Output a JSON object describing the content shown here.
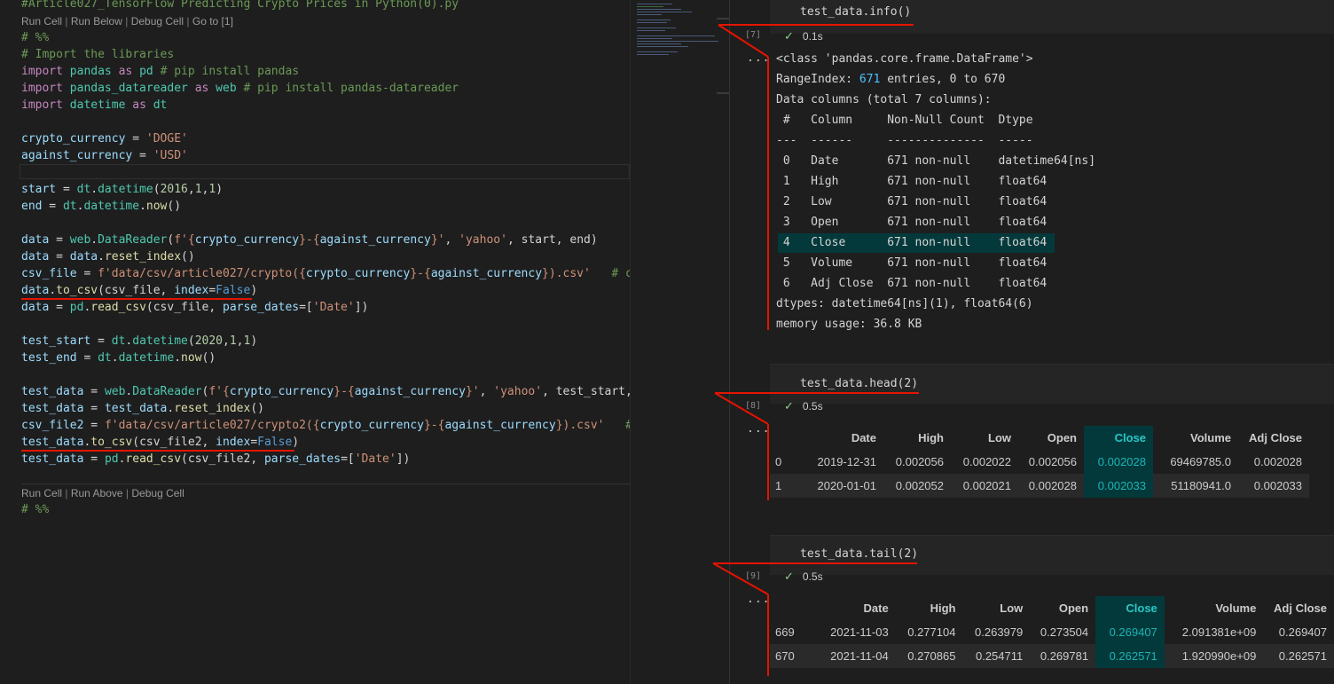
{
  "editor": {
    "file_header": "#Article027_TensorFlow Predicting Crypto Prices in Python(0).py",
    "top_lens": {
      "run_cell": "Run Cell",
      "run_below": "Run Below",
      "debug_cell": "Debug Cell",
      "go_to": "Go to [1]",
      "sep": "|"
    },
    "bottom_lens": {
      "run_cell": "Run Cell",
      "run_above": "Run Above",
      "debug_cell": "Debug Cell",
      "sep": "|"
    },
    "code_lines": [
      [
        {
          "t": "# %%",
          "c": "cmt"
        }
      ],
      [
        {
          "t": "# Import the libraries",
          "c": "cmt"
        }
      ],
      [
        {
          "t": "import",
          "c": "kw"
        },
        {
          "t": " pandas ",
          "c": "mod"
        },
        {
          "t": "as",
          "c": "kw"
        },
        {
          "t": " pd ",
          "c": "mod"
        },
        {
          "t": "# pip install pandas",
          "c": "cmt"
        }
      ],
      [
        {
          "t": "import",
          "c": "kw"
        },
        {
          "t": " pandas_datareader ",
          "c": "mod"
        },
        {
          "t": "as",
          "c": "kw"
        },
        {
          "t": " web ",
          "c": "mod"
        },
        {
          "t": "# pip install pandas-datareader",
          "c": "cmt"
        }
      ],
      [
        {
          "t": "import",
          "c": "kw"
        },
        {
          "t": " datetime ",
          "c": "mod"
        },
        {
          "t": "as",
          "c": "kw"
        },
        {
          "t": " dt",
          "c": "mod"
        }
      ],
      [],
      [
        {
          "t": "crypto_currency",
          "c": "var"
        },
        {
          "t": " = ",
          "c": "txt"
        },
        {
          "t": "'DOGE'",
          "c": "str"
        }
      ],
      [
        {
          "t": "against_currency",
          "c": "var"
        },
        {
          "t": " = ",
          "c": "txt"
        },
        {
          "t": "'USD'",
          "c": "str"
        }
      ],
      [],
      [
        {
          "t": "start",
          "c": "var"
        },
        {
          "t": " = ",
          "c": "txt"
        },
        {
          "t": "dt",
          "c": "mod"
        },
        {
          "t": ".",
          "c": "txt"
        },
        {
          "t": "datetime",
          "c": "mod"
        },
        {
          "t": "(",
          "c": "txt"
        },
        {
          "t": "2016",
          "c": "num"
        },
        {
          "t": ",",
          "c": "txt"
        },
        {
          "t": "1",
          "c": "num"
        },
        {
          "t": ",",
          "c": "txt"
        },
        {
          "t": "1",
          "c": "num"
        },
        {
          "t": ")",
          "c": "txt"
        }
      ],
      [
        {
          "t": "end",
          "c": "var"
        },
        {
          "t": " = ",
          "c": "txt"
        },
        {
          "t": "dt",
          "c": "mod"
        },
        {
          "t": ".",
          "c": "txt"
        },
        {
          "t": "datetime",
          "c": "mod"
        },
        {
          "t": ".",
          "c": "txt"
        },
        {
          "t": "now",
          "c": "fn"
        },
        {
          "t": "()",
          "c": "txt"
        }
      ],
      [],
      [
        {
          "t": "data",
          "c": "var"
        },
        {
          "t": " = ",
          "c": "txt"
        },
        {
          "t": "web",
          "c": "mod"
        },
        {
          "t": ".",
          "c": "txt"
        },
        {
          "t": "DataReader",
          "c": "mod"
        },
        {
          "t": "(",
          "c": "txt"
        },
        {
          "t": "f'{",
          "c": "str"
        },
        {
          "t": "crypto_currency",
          "c": "var"
        },
        {
          "t": "}-{",
          "c": "str"
        },
        {
          "t": "against_currency",
          "c": "var"
        },
        {
          "t": "}'",
          "c": "str"
        },
        {
          "t": ", ",
          "c": "txt"
        },
        {
          "t": "'yahoo'",
          "c": "str"
        },
        {
          "t": ", start, end)",
          "c": "txt"
        }
      ],
      [
        {
          "t": "data",
          "c": "var"
        },
        {
          "t": " = ",
          "c": "txt"
        },
        {
          "t": "data",
          "c": "var"
        },
        {
          "t": ".",
          "c": "txt"
        },
        {
          "t": "reset_index",
          "c": "fn"
        },
        {
          "t": "()",
          "c": "txt"
        }
      ],
      [
        {
          "t": "csv_file",
          "c": "var"
        },
        {
          "t": " = ",
          "c": "txt"
        },
        {
          "t": "f'data/csv/article027/crypto({",
          "c": "str"
        },
        {
          "t": "crypto_currency",
          "c": "var"
        },
        {
          "t": "}-{",
          "c": "str"
        },
        {
          "t": "against_currency",
          "c": "var"
        },
        {
          "t": "}).csv'",
          "c": "str"
        },
        {
          "t": "   # cr",
          "c": "cmt"
        }
      ],
      [
        {
          "t": "data",
          "c": "var"
        },
        {
          "t": ".",
          "c": "txt"
        },
        {
          "t": "to_csv",
          "c": "fn"
        },
        {
          "t": "(csv_file, ",
          "c": "txt"
        },
        {
          "t": "index",
          "c": "var"
        },
        {
          "t": "=",
          "c": "txt"
        },
        {
          "t": "False",
          "c": "kwb"
        },
        {
          "t": ")",
          "c": "txt"
        }
      ],
      [
        {
          "t": "data",
          "c": "var"
        },
        {
          "t": " = ",
          "c": "txt"
        },
        {
          "t": "pd",
          "c": "mod"
        },
        {
          "t": ".",
          "c": "txt"
        },
        {
          "t": "read_csv",
          "c": "fn"
        },
        {
          "t": "(csv_file, ",
          "c": "txt"
        },
        {
          "t": "parse_dates",
          "c": "var"
        },
        {
          "t": "=[",
          "c": "txt"
        },
        {
          "t": "'Date'",
          "c": "str"
        },
        {
          "t": "])",
          "c": "txt"
        }
      ],
      [],
      [
        {
          "t": "test_start",
          "c": "var"
        },
        {
          "t": " = ",
          "c": "txt"
        },
        {
          "t": "dt",
          "c": "mod"
        },
        {
          "t": ".",
          "c": "txt"
        },
        {
          "t": "datetime",
          "c": "mod"
        },
        {
          "t": "(",
          "c": "txt"
        },
        {
          "t": "2020",
          "c": "num"
        },
        {
          "t": ",",
          "c": "txt"
        },
        {
          "t": "1",
          "c": "num"
        },
        {
          "t": ",",
          "c": "txt"
        },
        {
          "t": "1",
          "c": "num"
        },
        {
          "t": ")",
          "c": "txt"
        }
      ],
      [
        {
          "t": "test_end",
          "c": "var"
        },
        {
          "t": " = ",
          "c": "txt"
        },
        {
          "t": "dt",
          "c": "mod"
        },
        {
          "t": ".",
          "c": "txt"
        },
        {
          "t": "datetime",
          "c": "mod"
        },
        {
          "t": ".",
          "c": "txt"
        },
        {
          "t": "now",
          "c": "fn"
        },
        {
          "t": "()",
          "c": "txt"
        }
      ],
      [],
      [
        {
          "t": "test_data",
          "c": "var"
        },
        {
          "t": " = ",
          "c": "txt"
        },
        {
          "t": "web",
          "c": "mod"
        },
        {
          "t": ".",
          "c": "txt"
        },
        {
          "t": "DataReader",
          "c": "mod"
        },
        {
          "t": "(",
          "c": "txt"
        },
        {
          "t": "f'{",
          "c": "str"
        },
        {
          "t": "crypto_currency",
          "c": "var"
        },
        {
          "t": "}-{",
          "c": "str"
        },
        {
          "t": "against_currency",
          "c": "var"
        },
        {
          "t": "}'",
          "c": "str"
        },
        {
          "t": ", ",
          "c": "txt"
        },
        {
          "t": "'yahoo'",
          "c": "str"
        },
        {
          "t": ", test_start, t",
          "c": "txt"
        }
      ],
      [
        {
          "t": "test_data",
          "c": "var"
        },
        {
          "t": " = ",
          "c": "txt"
        },
        {
          "t": "test_data",
          "c": "var"
        },
        {
          "t": ".",
          "c": "txt"
        },
        {
          "t": "reset_index",
          "c": "fn"
        },
        {
          "t": "()",
          "c": "txt"
        }
      ],
      [
        {
          "t": "csv_file2",
          "c": "var"
        },
        {
          "t": " = ",
          "c": "txt"
        },
        {
          "t": "f'data/csv/article027/crypto2({",
          "c": "str"
        },
        {
          "t": "crypto_currency",
          "c": "var"
        },
        {
          "t": "}-{",
          "c": "str"
        },
        {
          "t": "against_currency",
          "c": "var"
        },
        {
          "t": "}).csv'",
          "c": "str"
        },
        {
          "t": "   # ",
          "c": "cmt"
        }
      ],
      [
        {
          "t": "test_data",
          "c": "var"
        },
        {
          "t": ".",
          "c": "txt"
        },
        {
          "t": "to_csv",
          "c": "fn"
        },
        {
          "t": "(csv_file2, ",
          "c": "txt"
        },
        {
          "t": "index",
          "c": "var"
        },
        {
          "t": "=",
          "c": "txt"
        },
        {
          "t": "False",
          "c": "kwb"
        },
        {
          "t": ")",
          "c": "txt"
        }
      ],
      [
        {
          "t": "test_data",
          "c": "var"
        },
        {
          "t": " = ",
          "c": "txt"
        },
        {
          "t": "pd",
          "c": "mod"
        },
        {
          "t": ".",
          "c": "txt"
        },
        {
          "t": "read_csv",
          "c": "fn"
        },
        {
          "t": "(csv_file2, ",
          "c": "txt"
        },
        {
          "t": "parse_dates",
          "c": "var"
        },
        {
          "t": "=[",
          "c": "txt"
        },
        {
          "t": "'Date'",
          "c": "str"
        },
        {
          "t": "])",
          "c": "txt"
        }
      ]
    ],
    "trailing_line": "# %%"
  },
  "notebook": {
    "cells": [
      {
        "code": "test_data.info()",
        "count": "[7]",
        "time": "0.1s",
        "more": "...",
        "output_lines": [
          {
            "pre": "<class 'pandas.core.frame.DataFrame'>",
            "hl": "",
            "post": ""
          },
          {
            "pre": "RangeIndex: ",
            "hl": "671",
            "post": " entries, 0 to 670"
          },
          {
            "pre": "Data columns (total 7 columns):",
            "hl": "",
            "post": ""
          },
          {
            "pre": " #   Column     Non-Null Count  Dtype",
            "hl": "",
            "post": ""
          },
          {
            "pre": "---  ------     --------------  -----",
            "hl": "",
            "post": ""
          },
          {
            "pre": " 0   Date       671 non-null    datetime64[ns]",
            "hl": "",
            "post": ""
          },
          {
            "pre": " 1   High       671 non-null    float64",
            "hl": "",
            "post": ""
          },
          {
            "pre": " 2   Low        671 non-null    float64",
            "hl": "",
            "post": ""
          },
          {
            "pre": " 3   Open       671 non-null    float64",
            "hl": "",
            "post": ""
          },
          {
            "pre": " 4   Close      671 non-null    float64",
            "hl": "",
            "post": ""
          },
          {
            "pre": " 5   Volume     671 non-null    float64",
            "hl": "",
            "post": ""
          },
          {
            "pre": " 6   Adj Close  671 non-null    float64",
            "hl": "",
            "post": ""
          },
          {
            "pre": "dtypes: datetime64[ns](1), float64(6)",
            "hl": "",
            "post": ""
          },
          {
            "pre": "memory usage: 36.8 KB",
            "hl": "",
            "post": ""
          }
        ]
      },
      {
        "code": "test_data.head(2)",
        "count": "[8]",
        "time": "0.5s",
        "more": "...",
        "table": {
          "columns": [
            "",
            "Date",
            "High",
            "Low",
            "Open",
            "Close",
            "Volume",
            "Adj Close"
          ],
          "rows": [
            [
              "0",
              "2019-12-31",
              "0.002056",
              "0.002022",
              "0.002056",
              "0.002028",
              "69469785.0",
              "0.002028"
            ],
            [
              "1",
              "2020-01-01",
              "0.002052",
              "0.002021",
              "0.002028",
              "0.002033",
              "51180941.0",
              "0.002033"
            ]
          ]
        }
      },
      {
        "code": "test_data.tail(2)",
        "count": "[9]",
        "time": "0.5s",
        "more": "...",
        "table": {
          "columns": [
            "",
            "Date",
            "High",
            "Low",
            "Open",
            "Close",
            "Volume",
            "Adj Close"
          ],
          "rows": [
            [
              "669",
              "2021-11-03",
              "0.277104",
              "0.263979",
              "0.273504",
              "0.269407",
              "2.091381e+09",
              "0.269407"
            ],
            [
              "670",
              "2021-11-04",
              "0.270865",
              "0.254711",
              "0.269781",
              "0.262571",
              "1.920990e+09",
              "0.262571"
            ]
          ]
        }
      }
    ],
    "status_icon": "check-icon",
    "check_glyph": "✓"
  },
  "colors": {
    "annotation": "#e51400",
    "highlight_bg": "#04393b",
    "highlight_text": "#29c7c7"
  }
}
